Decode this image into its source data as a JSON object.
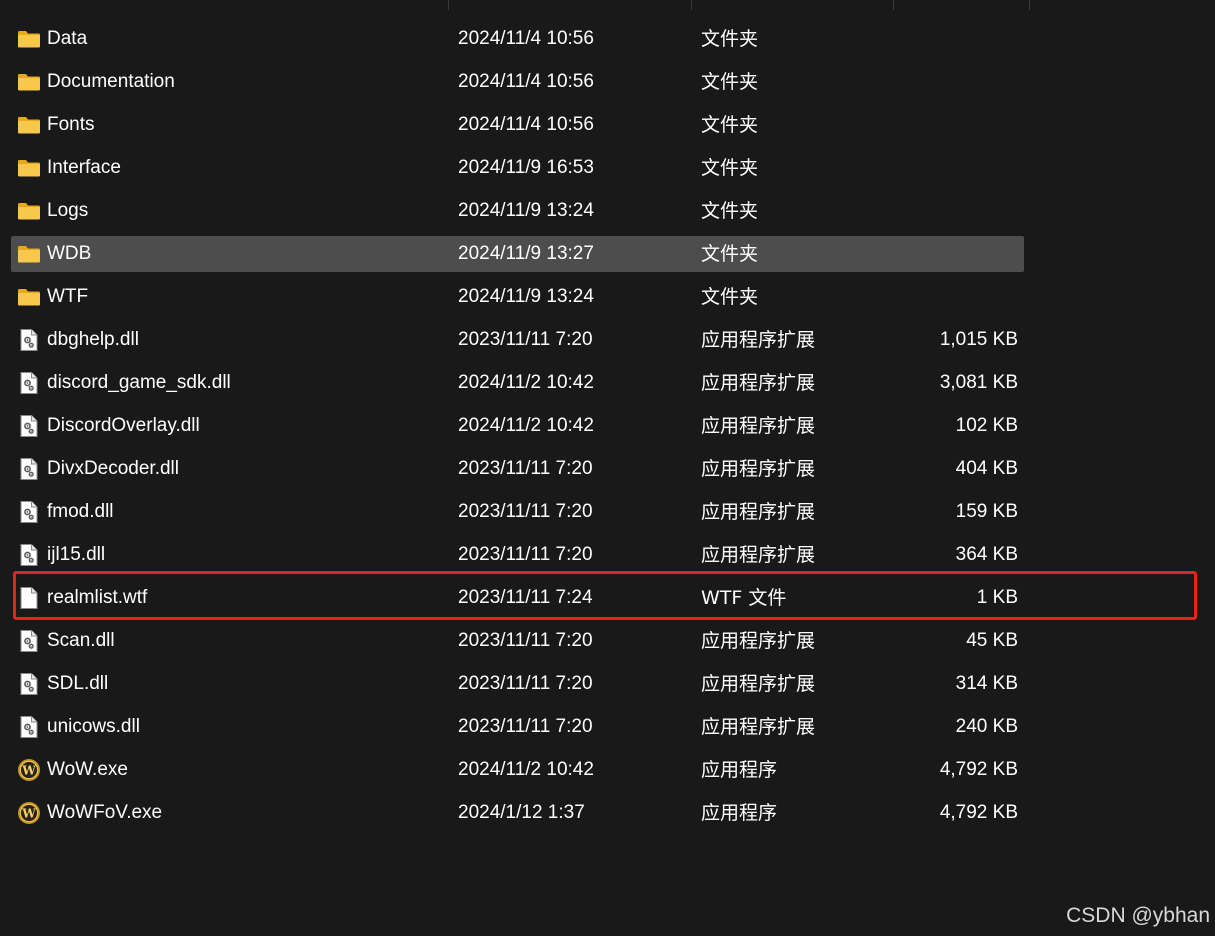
{
  "files": [
    {
      "name": "Data",
      "date": "2024/11/4 10:56",
      "type": "文件夹",
      "size": "",
      "icon": "folder-icon"
    },
    {
      "name": "Documentation",
      "date": "2024/11/4 10:56",
      "type": "文件夹",
      "size": "",
      "icon": "folder-icon"
    },
    {
      "name": "Fonts",
      "date": "2024/11/4 10:56",
      "type": "文件夹",
      "size": "",
      "icon": "folder-icon"
    },
    {
      "name": "Interface",
      "date": "2024/11/9 16:53",
      "type": "文件夹",
      "size": "",
      "icon": "folder-icon"
    },
    {
      "name": "Logs",
      "date": "2024/11/9 13:24",
      "type": "文件夹",
      "size": "",
      "icon": "folder-icon"
    },
    {
      "name": "WDB",
      "date": "2024/11/9 13:27",
      "type": "文件夹",
      "size": "",
      "icon": "folder-icon",
      "selected": true
    },
    {
      "name": "WTF",
      "date": "2024/11/9 13:24",
      "type": "文件夹",
      "size": "",
      "icon": "folder-icon"
    },
    {
      "name": "dbghelp.dll",
      "date": "2023/11/11 7:20",
      "type": "应用程序扩展",
      "size": "1,015 KB",
      "icon": "dll-file-icon"
    },
    {
      "name": "discord_game_sdk.dll",
      "date": "2024/11/2 10:42",
      "type": "应用程序扩展",
      "size": "3,081 KB",
      "icon": "dll-file-icon"
    },
    {
      "name": "DiscordOverlay.dll",
      "date": "2024/11/2 10:42",
      "type": "应用程序扩展",
      "size": "102 KB",
      "icon": "dll-file-icon"
    },
    {
      "name": "DivxDecoder.dll",
      "date": "2023/11/11 7:20",
      "type": "应用程序扩展",
      "size": "404 KB",
      "icon": "dll-file-icon"
    },
    {
      "name": "fmod.dll",
      "date": "2023/11/11 7:20",
      "type": "应用程序扩展",
      "size": "159 KB",
      "icon": "dll-file-icon"
    },
    {
      "name": "ijl15.dll",
      "date": "2023/11/11 7:20",
      "type": "应用程序扩展",
      "size": "364 KB",
      "icon": "dll-file-icon"
    },
    {
      "name": "realmlist.wtf",
      "date": "2023/11/11 7:24",
      "type": "WTF 文件",
      "size": "1 KB",
      "icon": "blank-file-icon",
      "highlighted": true
    },
    {
      "name": "Scan.dll",
      "date": "2023/11/11 7:20",
      "type": "应用程序扩展",
      "size": "45 KB",
      "icon": "dll-file-icon"
    },
    {
      "name": "SDL.dll",
      "date": "2023/11/11 7:20",
      "type": "应用程序扩展",
      "size": "314 KB",
      "icon": "dll-file-icon"
    },
    {
      "name": "unicows.dll",
      "date": "2023/11/11 7:20",
      "type": "应用程序扩展",
      "size": "240 KB",
      "icon": "dll-file-icon"
    },
    {
      "name": "WoW.exe",
      "date": "2024/11/2 10:42",
      "type": "应用程序",
      "size": "4,792 KB",
      "icon": "wow-app-icon"
    },
    {
      "name": "WoWFoV.exe",
      "date": "2024/1/12 1:37",
      "type": "应用程序",
      "size": "4,792 KB",
      "icon": "wow-app-icon"
    }
  ],
  "watermark": "CSDN @ybhan",
  "colors": {
    "background": "#191919",
    "selection": "#4d4d4d",
    "callout_border": "#e8231d",
    "folder": "#f5c242"
  }
}
